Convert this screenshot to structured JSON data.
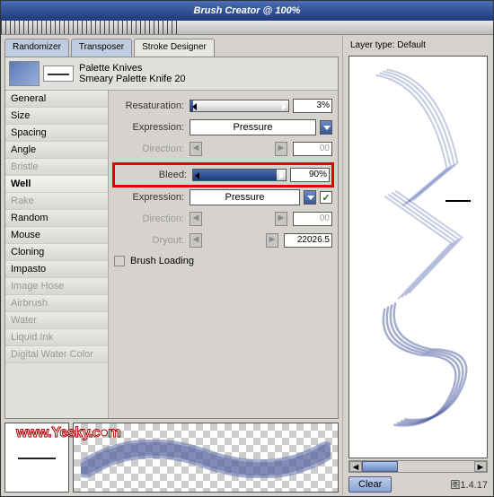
{
  "window": {
    "title": "Brush Creator @ 100%"
  },
  "tabs": {
    "randomizer": "Randomizer",
    "transposer": "Transposer",
    "stroke_designer": "Stroke Designer"
  },
  "brush": {
    "category": "Palette Knives",
    "variant": "Smeary Palette Knife 20"
  },
  "categories": [
    {
      "label": "General",
      "enabled": true
    },
    {
      "label": "Size",
      "enabled": true
    },
    {
      "label": "Spacing",
      "enabled": true
    },
    {
      "label": "Angle",
      "enabled": true
    },
    {
      "label": "Bristle",
      "enabled": false
    },
    {
      "label": "Well",
      "enabled": true,
      "selected": true
    },
    {
      "label": "Rake",
      "enabled": false
    },
    {
      "label": "Random",
      "enabled": true
    },
    {
      "label": "Mouse",
      "enabled": true
    },
    {
      "label": "Cloning",
      "enabled": true
    },
    {
      "label": "Impasto",
      "enabled": true
    },
    {
      "label": "Image Hose",
      "enabled": false
    },
    {
      "label": "Airbrush",
      "enabled": false
    },
    {
      "label": "Water",
      "enabled": false
    },
    {
      "label": "Liquid Ink",
      "enabled": false
    },
    {
      "label": "Digital Water Color",
      "enabled": false
    }
  ],
  "settings": {
    "resaturation_label": "Resaturation:",
    "resaturation_value": "3%",
    "resaturation_fill": "3%",
    "expression1_label": "Expression:",
    "expression1_value": "Pressure",
    "direction1_label": "Direction:",
    "direction1_value": "00",
    "bleed_label": "Bleed:",
    "bleed_value": "90%",
    "bleed_fill": "90%",
    "expression2_label": "Expression:",
    "expression2_value": "Pressure",
    "expression2_checked": "✓",
    "direction2_label": "Direction:",
    "direction2_value": "00",
    "dryout_label": "Dryout:",
    "dryout_value": "22026.5",
    "brush_loading_label": "Brush Loading"
  },
  "right": {
    "layer_type": "Layer type: Default",
    "clear": "Clear",
    "figure": "图1.4.17"
  },
  "watermark": "www.Yesky.c●m"
}
